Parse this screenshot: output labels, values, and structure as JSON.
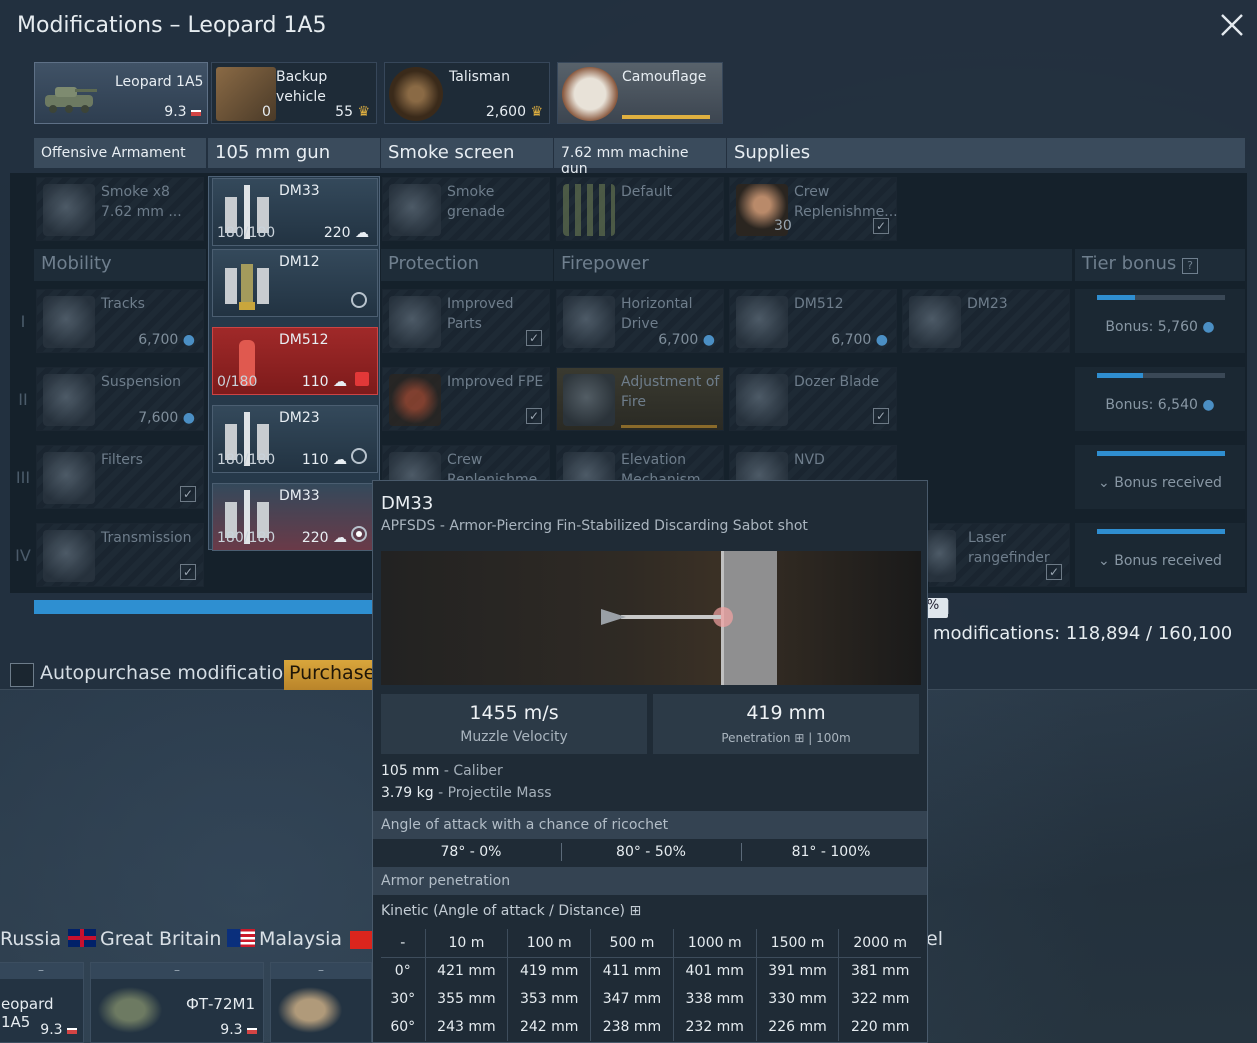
{
  "window": {
    "title": "Modifications – Leopard 1A5"
  },
  "top_items": [
    {
      "label": "Leopard 1A5",
      "value": "9.3"
    },
    {
      "label": "Backup vehicle",
      "count": "0",
      "value": "55"
    },
    {
      "label": "Talisman",
      "value": "2,600"
    },
    {
      "label": "Camouflage"
    }
  ],
  "columns": [
    "Offensive Armament",
    "105 mm gun",
    "Smoke screen",
    "7.62 mm machine gun",
    "Supplies"
  ],
  "offensive": {
    "smoke": {
      "name": "Smoke x8\n7.62 mm ..."
    },
    "smoke_grenade": {
      "name": "Smoke\ngrenade"
    },
    "default_mg": {
      "name": "Default"
    },
    "crew_rep": {
      "name": "Crew\nReplenishme...",
      "count": "30"
    }
  },
  "sections": [
    "Mobility",
    "Protection",
    "Firepower",
    "Tier bonus"
  ],
  "mobility": [
    {
      "name": "Tracks",
      "price": "6,700"
    },
    {
      "name": "Suspension",
      "price": "7,600"
    },
    {
      "name": "Filters"
    },
    {
      "name": "Transmission"
    }
  ],
  "protection": [
    {
      "name": "Improved\nParts"
    },
    {
      "name": "Improved FPE"
    },
    {
      "name": "Crew\nReplenishme"
    }
  ],
  "firepower": [
    {
      "name": "Horizontal\nDrive",
      "price": "6,700"
    },
    {
      "name": "DM512",
      "price": "6,700"
    },
    {
      "name": "DM23"
    },
    {
      "name": "Adjustment of\nFire"
    },
    {
      "name": "Dozer Blade"
    },
    {
      "name": "Elevation\nMechanism"
    },
    {
      "name": "NVD"
    },
    {
      "name": "Laser\nrangefinder"
    }
  ],
  "tier_labels": [
    "I",
    "II",
    "III",
    "IV"
  ],
  "tier_bonus": [
    {
      "text": "Bonus: 5,760",
      "fill": 0.3
    },
    {
      "text": "Bonus: 6,540",
      "fill": 0.36
    },
    {
      "text": "Bonus received",
      "fill": 1
    },
    {
      "text": "Bonus received",
      "fill": 1
    }
  ],
  "ammo_list": [
    {
      "name": "DM33",
      "count": "180/180",
      "price": "220",
      "state": "selected-top"
    },
    {
      "name": "DM12",
      "count": "",
      "price": "",
      "state": "radio"
    },
    {
      "name": "DM512",
      "count": "0/180",
      "price": "110",
      "state": "locked"
    },
    {
      "name": "DM23",
      "count": "180/180",
      "price": "110",
      "state": "radio"
    },
    {
      "name": "DM33",
      "count": "180/180",
      "price": "220",
      "state": "radio-on"
    }
  ],
  "progress": {
    "fraction": 0.82,
    "suffix": "%"
  },
  "mods_total": "modifications: 118,894 / 160,100",
  "autopurchase": {
    "label": "Autopurchase modifications",
    "button": "Purchase A"
  },
  "countries": [
    {
      "name": "Russia"
    },
    {
      "name": "Great Britain"
    },
    {
      "name": "Malaysia"
    }
  ],
  "country_tail": "el",
  "slots": [
    {
      "name": "eopard 1A5",
      "br": "9.3",
      "top": "–"
    },
    {
      "name": "ФТ-72М1",
      "br": "9.3",
      "top": "–"
    },
    {
      "name": "",
      "br": "",
      "top": "–"
    }
  ],
  "tooltip": {
    "title": "DM33",
    "subtitle": "APFSDS - Armor-Piercing Fin-Stabilized Discarding Sabot shot",
    "muzzle_velocity": {
      "value": "1455 m/s",
      "label": "Muzzle Velocity"
    },
    "penetration": {
      "value": "419 mm",
      "label": "Penetration",
      "dist": "| 100m"
    },
    "caliber": {
      "value": "105 mm",
      "label": "- Caliber"
    },
    "mass": {
      "value": "3.79 kg",
      "label": "- Projectile Mass"
    },
    "ricochet_title": "Angle of attack with a chance of ricochet",
    "ricochet": [
      "78° - 0%",
      "80° - 50%",
      "81° - 100%"
    ],
    "armor_pen_title": "Armor penetration",
    "kinetic_label": "Kinetic (Angle of attack / Distance)",
    "table": {
      "headers": [
        "-",
        "10 m",
        "100 m",
        "500 m",
        "1000 m",
        "1500 m",
        "2000 m"
      ],
      "rows": [
        [
          "0°",
          "421 mm",
          "419 mm",
          "411 mm",
          "401 mm",
          "391 mm",
          "381 mm"
        ],
        [
          "30°",
          "355 mm",
          "353 mm",
          "347 mm",
          "338 mm",
          "330 mm",
          "322 mm"
        ],
        [
          "60°",
          "243 mm",
          "242 mm",
          "238 mm",
          "232 mm",
          "226 mm",
          "220 mm"
        ]
      ]
    }
  },
  "colors": {
    "accent": "#2e8fd1",
    "gold": "#d9a63c",
    "locked": "#a02929"
  }
}
